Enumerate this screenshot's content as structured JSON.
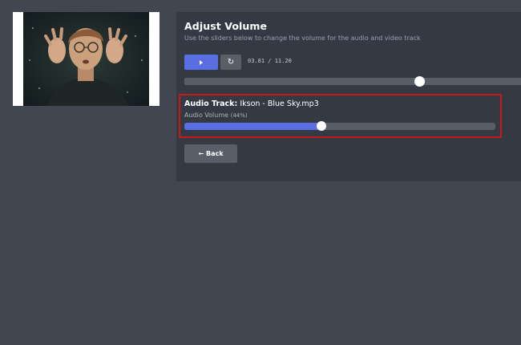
{
  "thumbnail": {
    "description_icon": "video-thumbnail"
  },
  "panel": {
    "title": "Adjust Volume",
    "subtitle": "Use the sliders below to change the volume for the audio and video track"
  },
  "player": {
    "play_icon": "play-icon",
    "restart_icon": "restart-icon",
    "restart_glyph": "↻",
    "time": "03.81 / 11.20",
    "seek_fraction": 0.698
  },
  "audio": {
    "label": "Audio Track:",
    "filename": "Ikson - Blue Sky.mp3",
    "volume_label": "Audio Volume",
    "volume_percent_text": "(44%)",
    "volume_fraction": 0.44
  },
  "back_button": {
    "arrow": "←",
    "label": "Back"
  },
  "colors": {
    "background": "#424651",
    "panel": "#353944",
    "accent": "#5a6ee3",
    "highlight": "#c61a1a"
  }
}
